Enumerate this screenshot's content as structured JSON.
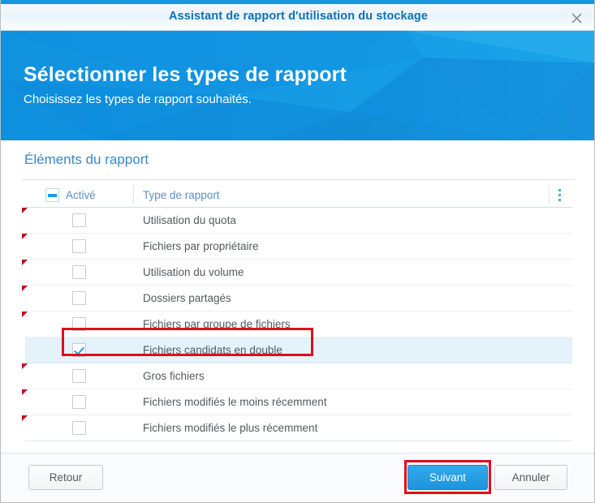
{
  "window": {
    "title": "Assistant de rapport d'utilisation du stockage",
    "close_icon": "close-icon"
  },
  "hero": {
    "title": "Sélectionner les types de rapport",
    "subtitle": "Choisissez les types de rapport souhaités."
  },
  "section": {
    "title": "Éléments du rapport"
  },
  "table": {
    "header": {
      "enabled_label": "Activé",
      "type_label": "Type de rapport",
      "select_all_state": "indeterminate",
      "menu_icon": "kebab-menu-icon"
    },
    "rows": [
      {
        "label": "Utilisation du quota",
        "checked": false,
        "selected": false
      },
      {
        "label": "Fichiers par propriétaire",
        "checked": false,
        "selected": false
      },
      {
        "label": "Utilisation du volume",
        "checked": false,
        "selected": false
      },
      {
        "label": "Dossiers partagés",
        "checked": false,
        "selected": false
      },
      {
        "label": "Fichiers par groupe de fichiers",
        "checked": false,
        "selected": false
      },
      {
        "label": "Fichiers candidats en double",
        "checked": true,
        "selected": true
      },
      {
        "label": "Gros fichiers",
        "checked": false,
        "selected": false
      },
      {
        "label": "Fichiers modifiés le moins récemment",
        "checked": false,
        "selected": false
      },
      {
        "label": "Fichiers modifiés le plus récemment",
        "checked": false,
        "selected": false
      }
    ]
  },
  "footer": {
    "back_label": "Retour",
    "next_label": "Suivant",
    "cancel_label": "Annuler"
  },
  "colors": {
    "accent": "#1699e0",
    "title_text": "#1071b5",
    "section_title": "#3b87c8",
    "annotation": "#e00d1b",
    "selected_row": "#e3f2fb",
    "checkmark": "#22a2e8",
    "row_flag": "#c10b1e"
  }
}
